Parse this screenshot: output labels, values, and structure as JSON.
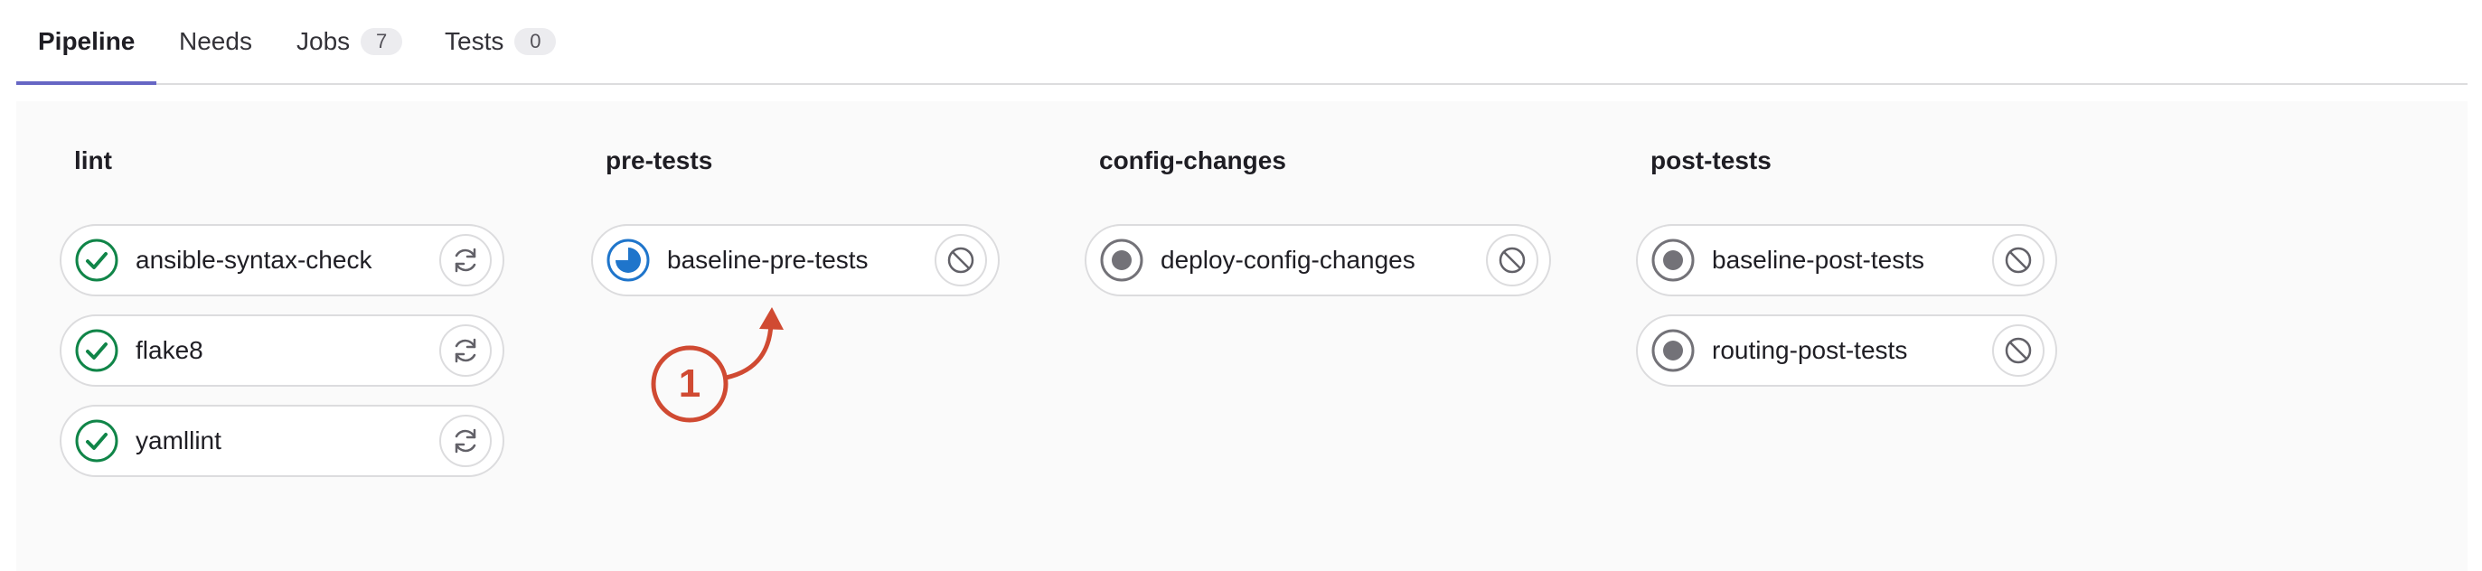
{
  "tabs": [
    {
      "label": "Pipeline",
      "active": true
    },
    {
      "label": "Needs",
      "active": false
    },
    {
      "label": "Jobs",
      "count": "7",
      "active": false
    },
    {
      "label": "Tests",
      "count": "0",
      "active": false
    }
  ],
  "stages": [
    {
      "title": "lint",
      "jobs": [
        {
          "name": "ansible-syntax-check",
          "status": "success",
          "action": "retry"
        },
        {
          "name": "flake8",
          "status": "success",
          "action": "retry"
        },
        {
          "name": "yamllint",
          "status": "success",
          "action": "retry"
        }
      ]
    },
    {
      "title": "pre-tests",
      "jobs": [
        {
          "name": "baseline-pre-tests",
          "status": "running",
          "action": "cancel"
        }
      ]
    },
    {
      "title": "config-changes",
      "jobs": [
        {
          "name": "deploy-config-changes",
          "status": "created",
          "action": "cancel"
        }
      ]
    },
    {
      "title": "post-tests",
      "jobs": [
        {
          "name": "baseline-post-tests",
          "status": "created",
          "action": "cancel"
        },
        {
          "name": "routing-post-tests",
          "status": "created",
          "action": "cancel"
        }
      ]
    }
  ],
  "annotation": {
    "number": "1"
  },
  "icons": {
    "success": "status-success-icon",
    "running": "status-running-icon",
    "created": "status-created-icon",
    "retry": "retry-icon",
    "cancel": "cancel-icon"
  },
  "colors": {
    "success": "#108548",
    "running": "#1f75cb",
    "created": "#737278",
    "tab_active_underline": "#6666c4",
    "annotation": "#d04a32"
  }
}
